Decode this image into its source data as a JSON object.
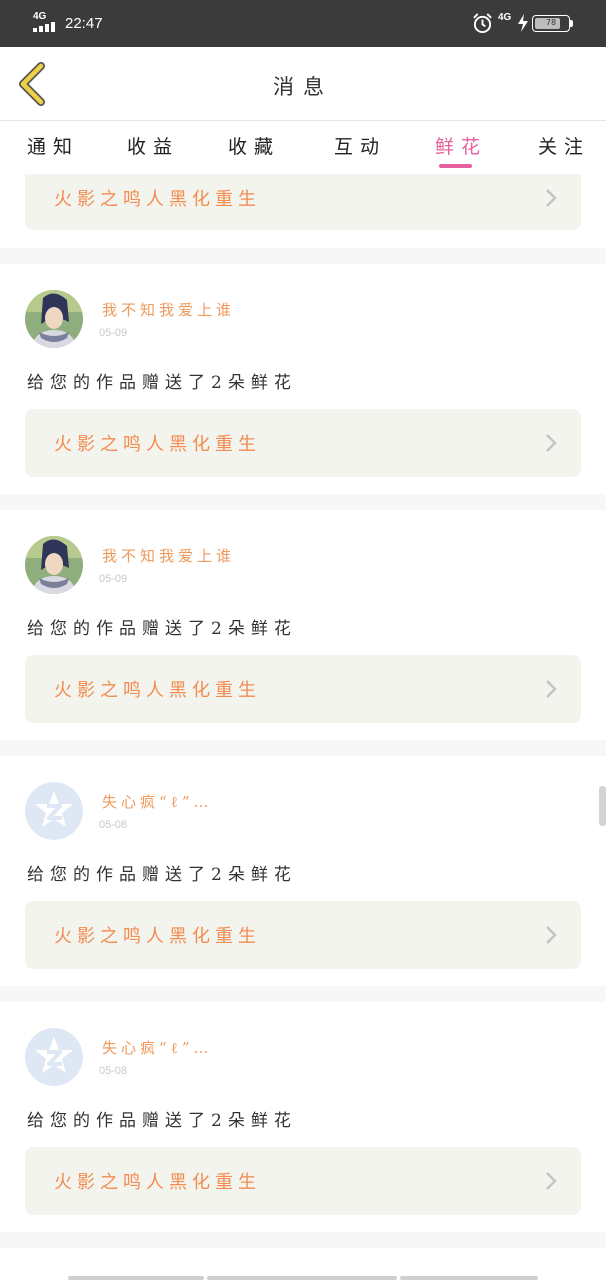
{
  "status_bar": {
    "network": "4G",
    "time": "22:47",
    "network2": "4G",
    "battery_level": "78"
  },
  "header": {
    "title": "消息",
    "back_icon": "chevron-left-icon",
    "back_color": "#f2d045"
  },
  "tabs": [
    {
      "label": "通知",
      "active": false
    },
    {
      "label": "收益",
      "active": false
    },
    {
      "label": "收藏",
      "active": false
    },
    {
      "label": "互动",
      "active": false
    },
    {
      "label": "鲜花",
      "active": true
    },
    {
      "label": "关注",
      "active": false
    }
  ],
  "colors": {
    "accent": "#e5609c",
    "username": "#ef9a5c",
    "work_title": "#f28c50"
  },
  "partial_card": {
    "work_title": "火影之鸣人黑化重生"
  },
  "messages": [
    {
      "username": "我不知我爱上谁",
      "date": "05-09",
      "text": "给您的作品赠送了2朵鲜花",
      "work_title": "火影之鸣人黑化重生",
      "avatar": "anime-avatar"
    },
    {
      "username": "我不知我爱上谁",
      "date": "05-09",
      "text": "给您的作品赠送了2朵鲜花",
      "work_title": "火影之鸣人黑化重生",
      "avatar": "anime-avatar"
    },
    {
      "username": "失心疯“ℓ”…",
      "date": "05-08",
      "text": "给您的作品赠送了2朵鲜花",
      "work_title": "火影之鸣人黑化重生",
      "avatar": "default-avatar"
    },
    {
      "username": "失心疯“ℓ”…",
      "date": "05-08",
      "text": "给您的作品赠送了2朵鲜花",
      "work_title": "火影之鸣人黑化重生",
      "avatar": "default-avatar"
    }
  ]
}
